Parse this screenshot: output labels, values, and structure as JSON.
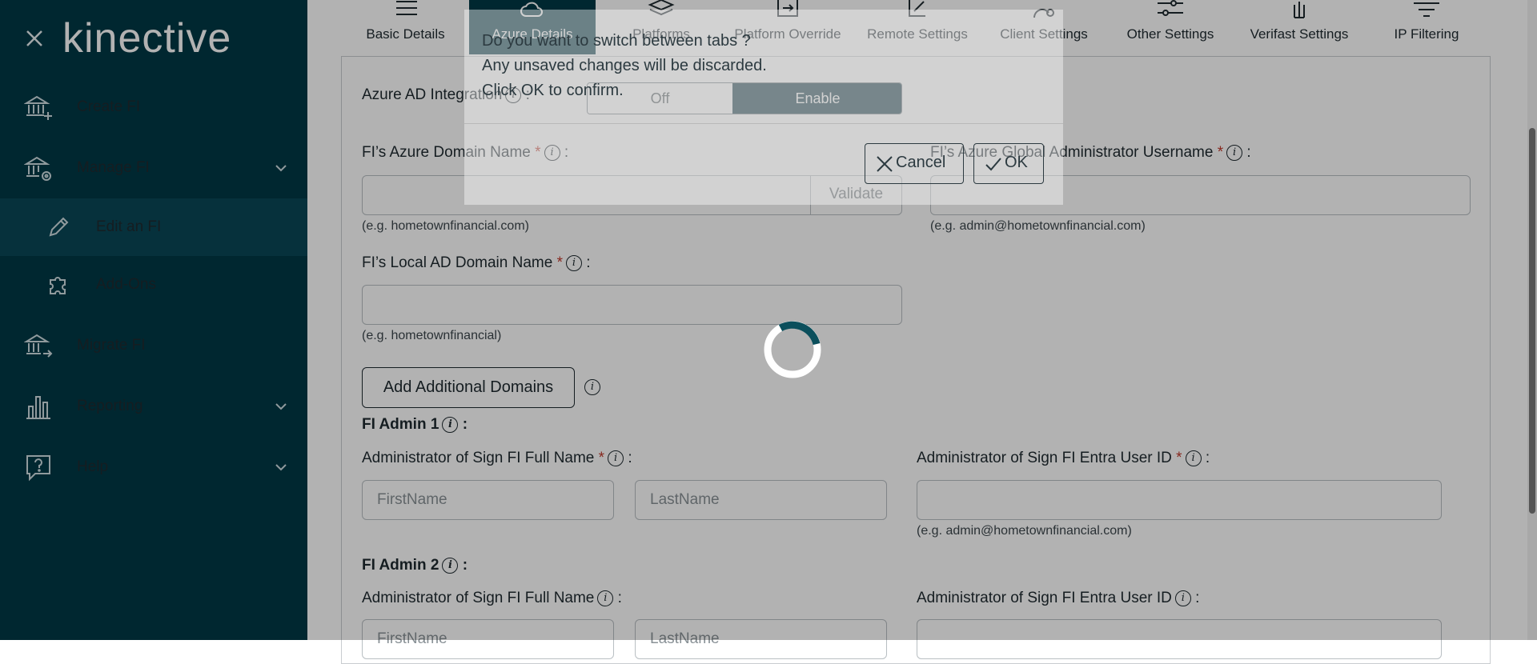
{
  "sidebar": {
    "logo": "kinective",
    "items": [
      {
        "label": "Create FI",
        "icon": "bank-plus-icon"
      },
      {
        "label": "Manage FI",
        "icon": "bank-gear-icon"
      },
      {
        "label": "Edit an FI",
        "icon": "pencil-icon"
      },
      {
        "label": "Add-Ons",
        "icon": "puzzle-icon"
      },
      {
        "label": "Migrate FI",
        "icon": "bank-arrow-icon"
      },
      {
        "label": "Reporting",
        "icon": "bar-chart-icon"
      },
      {
        "label": "Help",
        "icon": "help-bubble-icon"
      }
    ]
  },
  "tabs": [
    {
      "label": "Basic Details"
    },
    {
      "label": "Azure Details"
    },
    {
      "label": "Platforms"
    },
    {
      "label": "Platform Override"
    },
    {
      "label": "Remote Settings"
    },
    {
      "label": "Client Settings"
    },
    {
      "label": "Other Settings"
    },
    {
      "label": "Verifast Settings"
    },
    {
      "label": "IP Filtering"
    }
  ],
  "form": {
    "azure_ad_integration_label": "Azure AD Integration",
    "toggle": {
      "off_label": "Off",
      "on_label": "Enable",
      "selected": "Enable"
    },
    "azure_domain_label": "FI’s Azure Domain Name",
    "azure_domain_hint": "(e.g. hometownfinancial.com)",
    "validate_label": "Validate",
    "global_admin_label": "FI’s Azure Global Administrator Username",
    "global_admin_hint": "(e.g. admin@hometownfinancial.com)",
    "local_ad_label": "FI’s Local AD Domain Name",
    "local_ad_hint": "(e.g. hometownfinancial)",
    "add_domains_label": "Add Additional Domains",
    "admin1_title": "FI Admin 1",
    "admin2_title": "FI Admin 2",
    "full_name_label": "Administrator of Sign FI Full Name",
    "entra_id_label": "Administrator of Sign FI Entra User ID",
    "first_name_placeholder": "FirstName",
    "last_name_placeholder": "LastName",
    "entra_hint": "(e.g. admin@hometownfinancial.com)",
    "colon": ":",
    "required_mark": "*",
    "info_glyph": "i"
  },
  "dialog": {
    "line1": "Do you want to switch between tabs ?",
    "line2": "Any unsaved changes will be discarded.",
    "line3": "Click OK to confirm.",
    "cancel_label": "Cancel",
    "ok_label": "OK"
  },
  "colors": {
    "sidebar_bg": "#003845",
    "accent": "#1f4550",
    "required": "#c0392b"
  }
}
